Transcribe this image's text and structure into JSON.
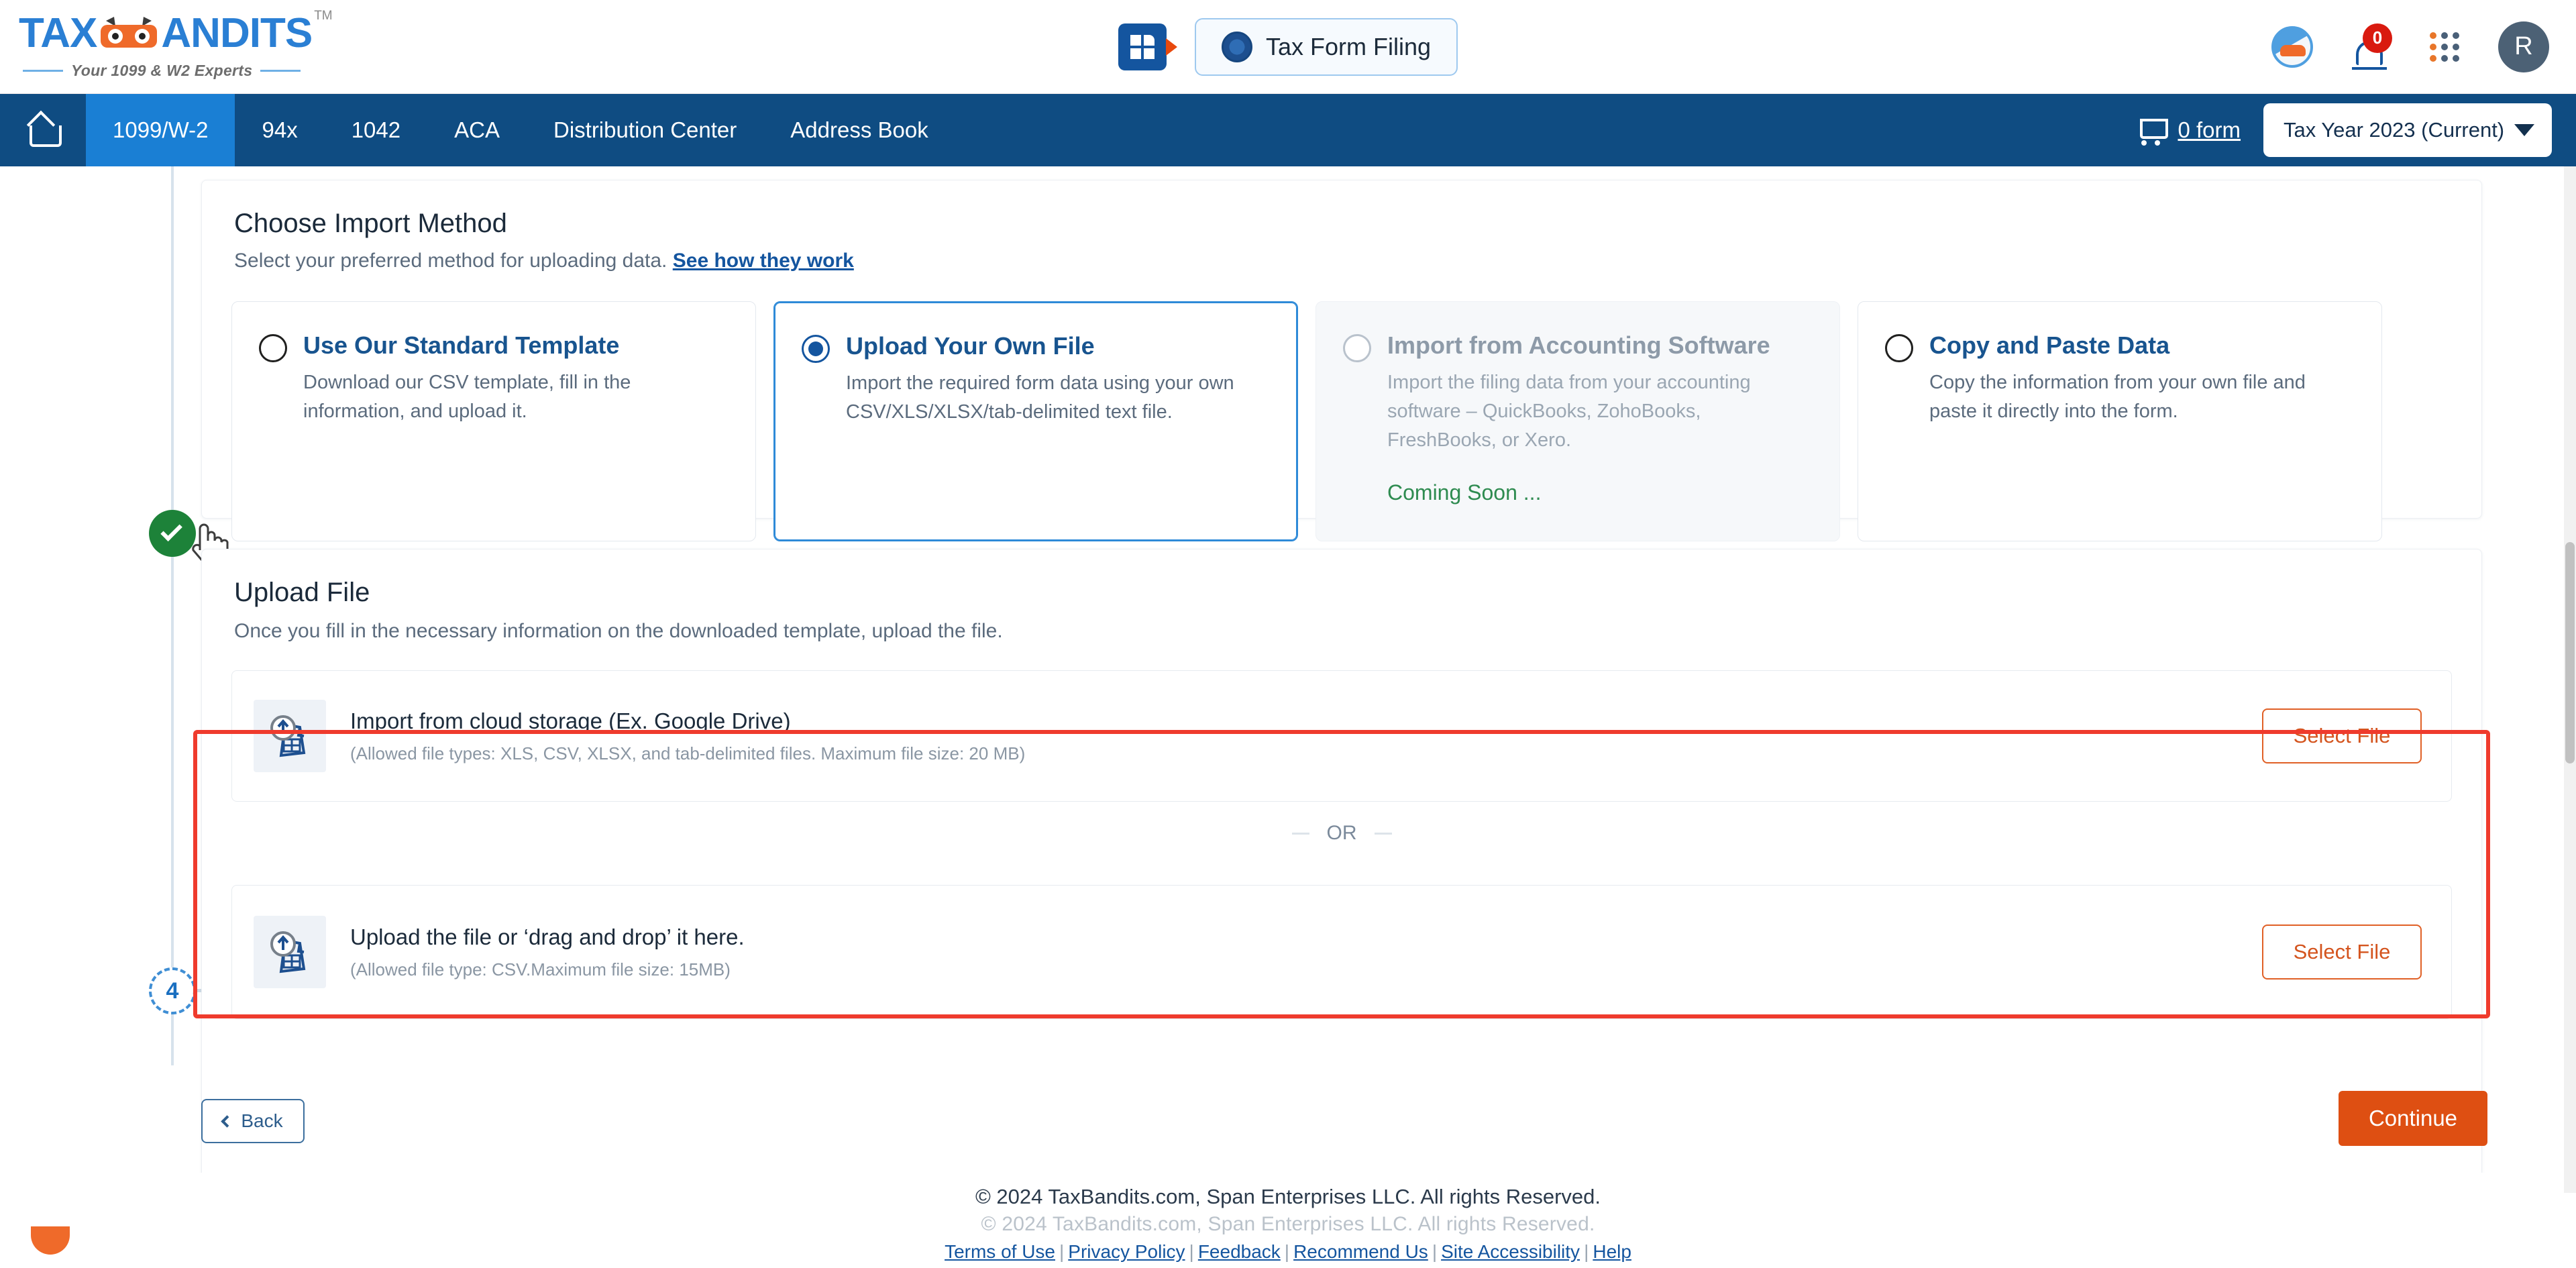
{
  "brand": {
    "name_part1": "TAX",
    "name_part2": "ANDITS",
    "tm": "TM",
    "tagline": "Your 1099 & W2 Experts"
  },
  "header": {
    "app_switcher_icon": "app-grid-icon",
    "filing_pill_label": "Tax Form Filing",
    "filing_pill_icon": "irs-seal-icon",
    "owl_icon": "owl-assistant-icon",
    "bell_icon": "notification-bell-icon",
    "notification_count": "0",
    "apps_icon": "apps-grid-icon",
    "avatar_initial": "R"
  },
  "nav": {
    "home_icon": "home-icon",
    "items": [
      {
        "label": "1099/W-2",
        "active": true
      },
      {
        "label": "94x",
        "active": false
      },
      {
        "label": "1042",
        "active": false
      },
      {
        "label": "ACA",
        "active": false
      },
      {
        "label": "Distribution Center",
        "active": false
      },
      {
        "label": "Address Book",
        "active": false
      }
    ],
    "cart_icon": "shopping-cart-icon",
    "cart_label": "0 form",
    "tax_year": "Tax Year 2023 (Current)"
  },
  "steps": {
    "completed_icon": "check-circle-icon",
    "current_number": "4"
  },
  "import_method": {
    "title": "Choose Import Method",
    "subtitle": "Select your preferred method for uploading data.",
    "help_link": "See how they work",
    "options": [
      {
        "title": "Use Our Standard Template",
        "desc": "Download our CSV template, fill in the information, and upload it.",
        "selected": false,
        "disabled": false,
        "note": ""
      },
      {
        "title": "Upload Your Own File",
        "desc": "Import the required form data using your own CSV/XLS/XLSX/tab-delimited text file.",
        "selected": true,
        "disabled": false,
        "note": ""
      },
      {
        "title": "Import from Accounting Software",
        "desc": "Import the filing data from your accounting software – QuickBooks, ZohoBooks, FreshBooks, or Xero.",
        "selected": false,
        "disabled": true,
        "note": "Coming Soon ..."
      },
      {
        "title": "Copy and Paste Data",
        "desc": "Copy the information from your own file and paste it directly into the form.",
        "selected": false,
        "disabled": false,
        "note": ""
      }
    ]
  },
  "upload_file": {
    "title": "Upload File",
    "subtitle": "Once you fill in the necessary information on the downloaded template, upload the file.",
    "divider_label": "OR",
    "rows": [
      {
        "icon": "file-upload-icon",
        "title": "Import from cloud storage (Ex. Google Drive)",
        "hint": "(Allowed file types: XLS, CSV, XLSX, and tab-delimited files. Maximum file size: 20 MB)",
        "button": "Select File"
      },
      {
        "icon": "file-upload-icon",
        "title": "Upload the file or ‘drag and drop’ it here.",
        "hint": "(Allowed file type: CSV.Maximum file size: 15MB)",
        "button": "Select File"
      }
    ]
  },
  "actions": {
    "back_label": "Back",
    "back_icon": "chevron-left-icon",
    "continue_label": "Continue"
  },
  "footer": {
    "copyright": "© 2024 TaxBandits.com, Span Enterprises LLC. All rights Reserved.",
    "copyright_ghost": "© 2024 TaxBandits.com, Span Enterprises LLC. All rights Reserved.",
    "links": [
      "Terms of Use",
      "Privacy Policy",
      "Feedback",
      "Recommend Us",
      "Site Accessibility",
      "Help"
    ],
    "separator": "|"
  },
  "colors": {
    "nav_blue": "#0f4c82",
    "nav_active": "#1a7fd4",
    "accent_orange": "#de4f12",
    "link_blue": "#14559f",
    "highlight_red": "#ef3b2d",
    "success_green": "#1d8239",
    "coming_soon_green": "#2e8b50"
  }
}
